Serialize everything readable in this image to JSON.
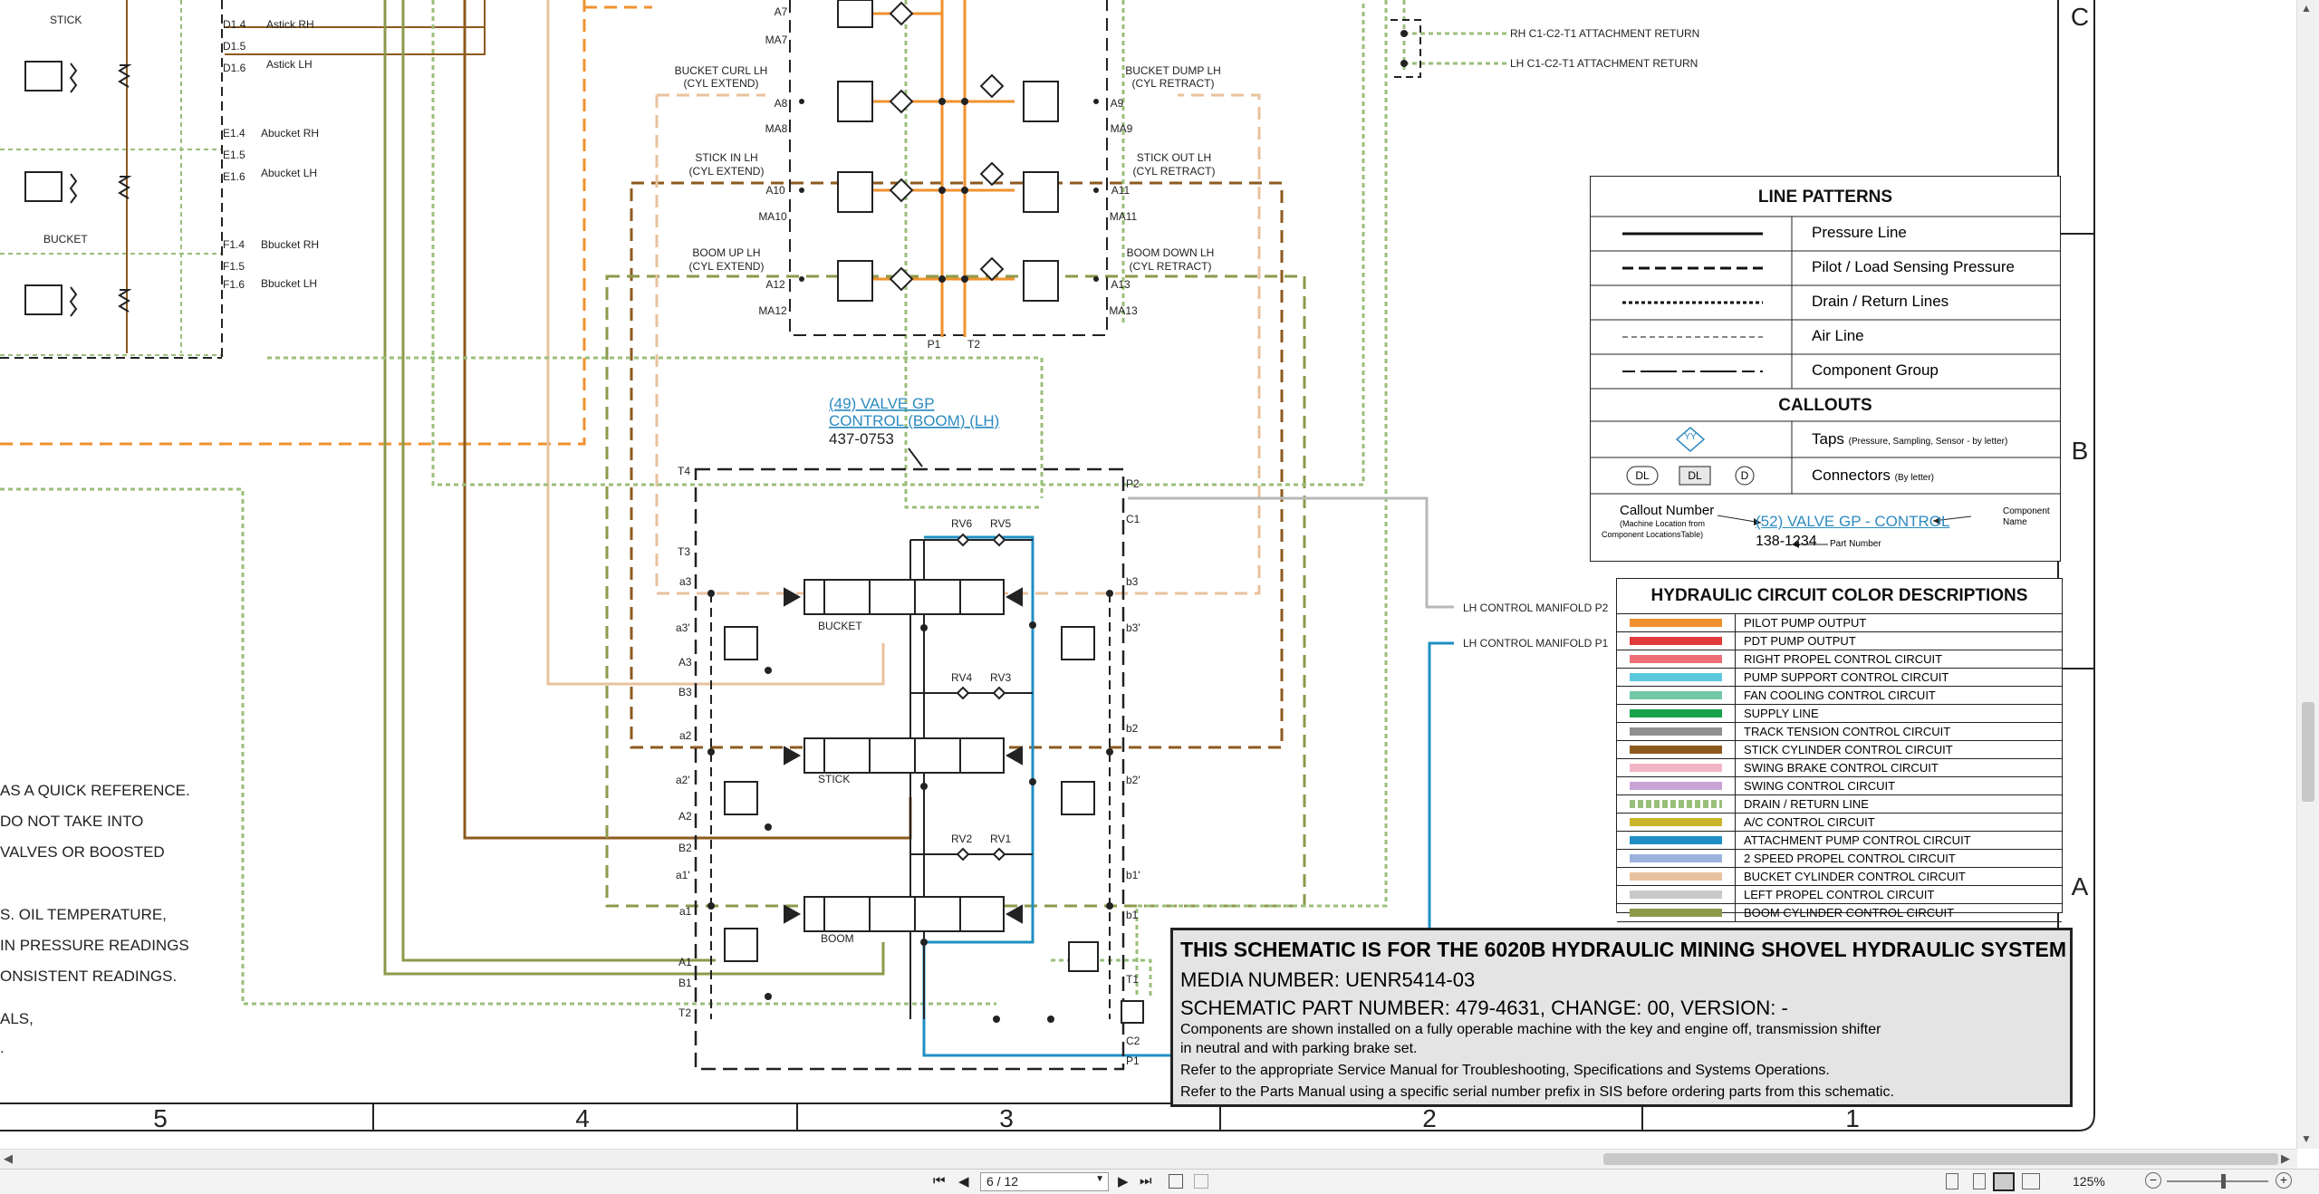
{
  "zone_labels": {
    "row_c": "C",
    "row_b": "B",
    "row_a": "A",
    "col_5": "5",
    "col_4": "4",
    "col_3": "3",
    "col_2": "2",
    "col_1": "1"
  },
  "left_notes": [
    "AS A QUICK REFERENCE.",
    "DO NOT TAKE INTO",
    "VALVES OR BOOSTED",
    "S. OIL TEMPERATURE,",
    "IN PRESSURE READINGS",
    "ONSISTENT READINGS.",
    "ALS,",
    "."
  ],
  "left_labels": {
    "stick": "STICK",
    "bucket": "BUCKET",
    "d14": "D1.4",
    "astick_rh": "Astick RH",
    "d15": "D1.5",
    "d16": "D1.6",
    "astick_lh": "Astick LH",
    "e14": "E1.4",
    "abucket_rh": "Abucket RH",
    "e15": "E1.5",
    "e16": "E1.6",
    "abucket_lh": "Abucket LH",
    "f14": "F1.4",
    "bbucket_rh": "Bbucket RH",
    "f15": "F1.5",
    "f16": "F1.6",
    "bbucket_lh": "Bbucket LH"
  },
  "upper_valve": {
    "a7": "A7",
    "ma7": "MA7",
    "bucket_curl": "BUCKET CURL LH",
    "bucket_curl_sub": "(CYL EXTEND)",
    "a8": "A8",
    "ma8": "MA8",
    "bucket_dump": "BUCKET DUMP LH",
    "bucket_dump_sub": "(CYL RETRACT)",
    "a9": "A9",
    "ma9": "MA9",
    "stick_in": "STICK IN LH",
    "stick_in_sub": "(CYL EXTEND)",
    "a10": "A10",
    "ma10": "MA10",
    "stick_out": "STICK OUT LH",
    "stick_out_sub": "(CYL RETRACT)",
    "a11": "A11",
    "ma11": "MA11",
    "boom_up": "BOOM UP LH",
    "boom_up_sub": "(CYL EXTEND)",
    "a12": "A12",
    "ma12": "MA12",
    "boom_down": "BOOM DOWN LH",
    "boom_down_sub": "(CYL RETRACT)",
    "a13": "A13",
    "ma13": "MA13",
    "p1": "P1",
    "t2": "T2"
  },
  "return_labels": {
    "rh_return": "RH C1-C2-T1 ATTACHMENT RETURN",
    "lh_return": "LH C1-C2-T1 ATTACHMENT RETURN"
  },
  "callout_49": {
    "line1": "(49) VALVE GP",
    "line2": "CONTROL (BOOM) (LH)",
    "part": "437-0753"
  },
  "main_valve": {
    "t4": "T4",
    "p2": "P2",
    "c1": "C1",
    "t3": "T3",
    "a3": "a3",
    "b3": "b3",
    "a3p": "a3'",
    "b3p": "b3'",
    "A3": "A3",
    "B3": "B3",
    "a2": "a2",
    "b2": "b2",
    "a2p": "a2'",
    "b2p": "b2'",
    "A2": "A2",
    "B2": "B2",
    "a1p": "a1'",
    "b1p": "b1'",
    "a1": "a1",
    "b1": "b1",
    "A1": "A1",
    "B1": "B1",
    "T2": "T2",
    "t1": "T1",
    "c2": "C2",
    "P1": "P1",
    "rv6": "RV6",
    "rv5": "RV5",
    "rv4": "RV4",
    "rv3": "RV3",
    "rv2": "RV2",
    "rv1": "RV1",
    "bucket": "BUCKET",
    "stick": "STICK",
    "boom": "BOOM"
  },
  "manifold_labels": {
    "p2": "LH CONTROL MANIFOLD P2",
    "p1": "LH CONTROL MANIFOLD P1"
  },
  "line_patterns": {
    "title": "LINE PATTERNS",
    "items": [
      "Pressure Line",
      "Pilot / Load Sensing Pressure",
      "Drain / Return Lines",
      "Air Line",
      "Component Group"
    ]
  },
  "callouts": {
    "title": "CALLOUTS",
    "taps_label": "Taps",
    "taps_note": "(Pressure, Sampling, Sensor - by letter)",
    "taps_symbol": "YY",
    "connectors_label": "Connectors",
    "connectors_note": "(By letter)",
    "conn_sym1": "DL",
    "conn_sym2": "DL",
    "conn_sym3": "D",
    "callout_number": "Callout Number",
    "callout_number_note1": "(Machine Location from",
    "callout_number_note2": "Component LocationsTable)",
    "example_link": "(52) VALVE GP - CONTROL",
    "example_part": "138-1234",
    "component_name1": "Component",
    "component_name2": "Name",
    "part_number": "Part Number"
  },
  "color_descriptions": {
    "title": "HYDRAULIC CIRCUIT COLOR DESCRIPTIONS",
    "items": [
      {
        "label": "PILOT PUMP OUTPUT",
        "color": "#f0912e"
      },
      {
        "label": "PDT PUMP OUTPUT",
        "color": "#e23b3b"
      },
      {
        "label": "RIGHT PROPEL CONTROL CIRCUIT",
        "color": "#ec6f77"
      },
      {
        "label": "PUMP SUPPORT CONTROL CIRCUIT",
        "color": "#5bc8dd"
      },
      {
        "label": "FAN COOLING CONTROL CIRCUIT",
        "color": "#72c8a6"
      },
      {
        "label": "SUPPLY LINE",
        "color": "#17a34a"
      },
      {
        "label": "TRACK TENSION CONTROL CIRCUIT",
        "color": "#8f8f8f"
      },
      {
        "label": "STICK CYLINDER CONTROL CIRCUIT",
        "color": "#8c5a1e"
      },
      {
        "label": "SWING BRAKE CONTROL CIRCUIT",
        "color": "#f2b6c6"
      },
      {
        "label": "SWING CONTROL CIRCUIT",
        "color": "#c9a3d6"
      },
      {
        "label": "DRAIN / RETURN LINE",
        "color": "#9abf7a"
      },
      {
        "label": "A/C CONTROL CIRCUIT",
        "color": "#c9b52a"
      },
      {
        "label": "ATTACHMENT PUMP CONTROL CIRCUIT",
        "color": "#1f8fc4"
      },
      {
        "label": "2 SPEED PROPEL CONTROL CIRCUIT",
        "color": "#9bb3dc"
      },
      {
        "label": "BUCKET CYLINDER CONTROL CIRCUIT",
        "color": "#e8c29e"
      },
      {
        "label": "LEFT PROPEL CONTROL CIRCUIT",
        "color": "#c9c9c9"
      },
      {
        "label": "BOOM CYLINDER CONTROL CIRCUIT",
        "color": "#8c9a4a"
      }
    ]
  },
  "title_block": {
    "line1": "THIS SCHEMATIC IS FOR THE 6020B HYDRAULIC MINING SHOVEL HYDRAULIC SYSTEM",
    "line2": "MEDIA NUMBER: UENR5414-03",
    "line3": "SCHEMATIC PART NUMBER: 479-4631, CHANGE: 00, VERSION: -",
    "line4": "Components are shown installed on a fully operable machine with the key and engine off, transmission shifter",
    "line5": "in neutral and with parking brake set.",
    "line6": "Refer to the appropriate Service Manual for Troubleshooting, Specifications and Systems Operations.",
    "line7": "Refer to the Parts Manual using a specific serial number prefix in SIS before ordering parts from this schematic."
  },
  "toolbar": {
    "page_value": "6 / 12",
    "zoom": "125%"
  },
  "colors": {
    "orange": "#f0912e",
    "brown": "#8c5a1e",
    "olive": "#8c9a4a",
    "tan": "#e8c29e",
    "green_dash": "#9abf7a",
    "gray": "#b8b8b8",
    "blue": "#1f8fc4",
    "link": "#2d8bc0"
  }
}
